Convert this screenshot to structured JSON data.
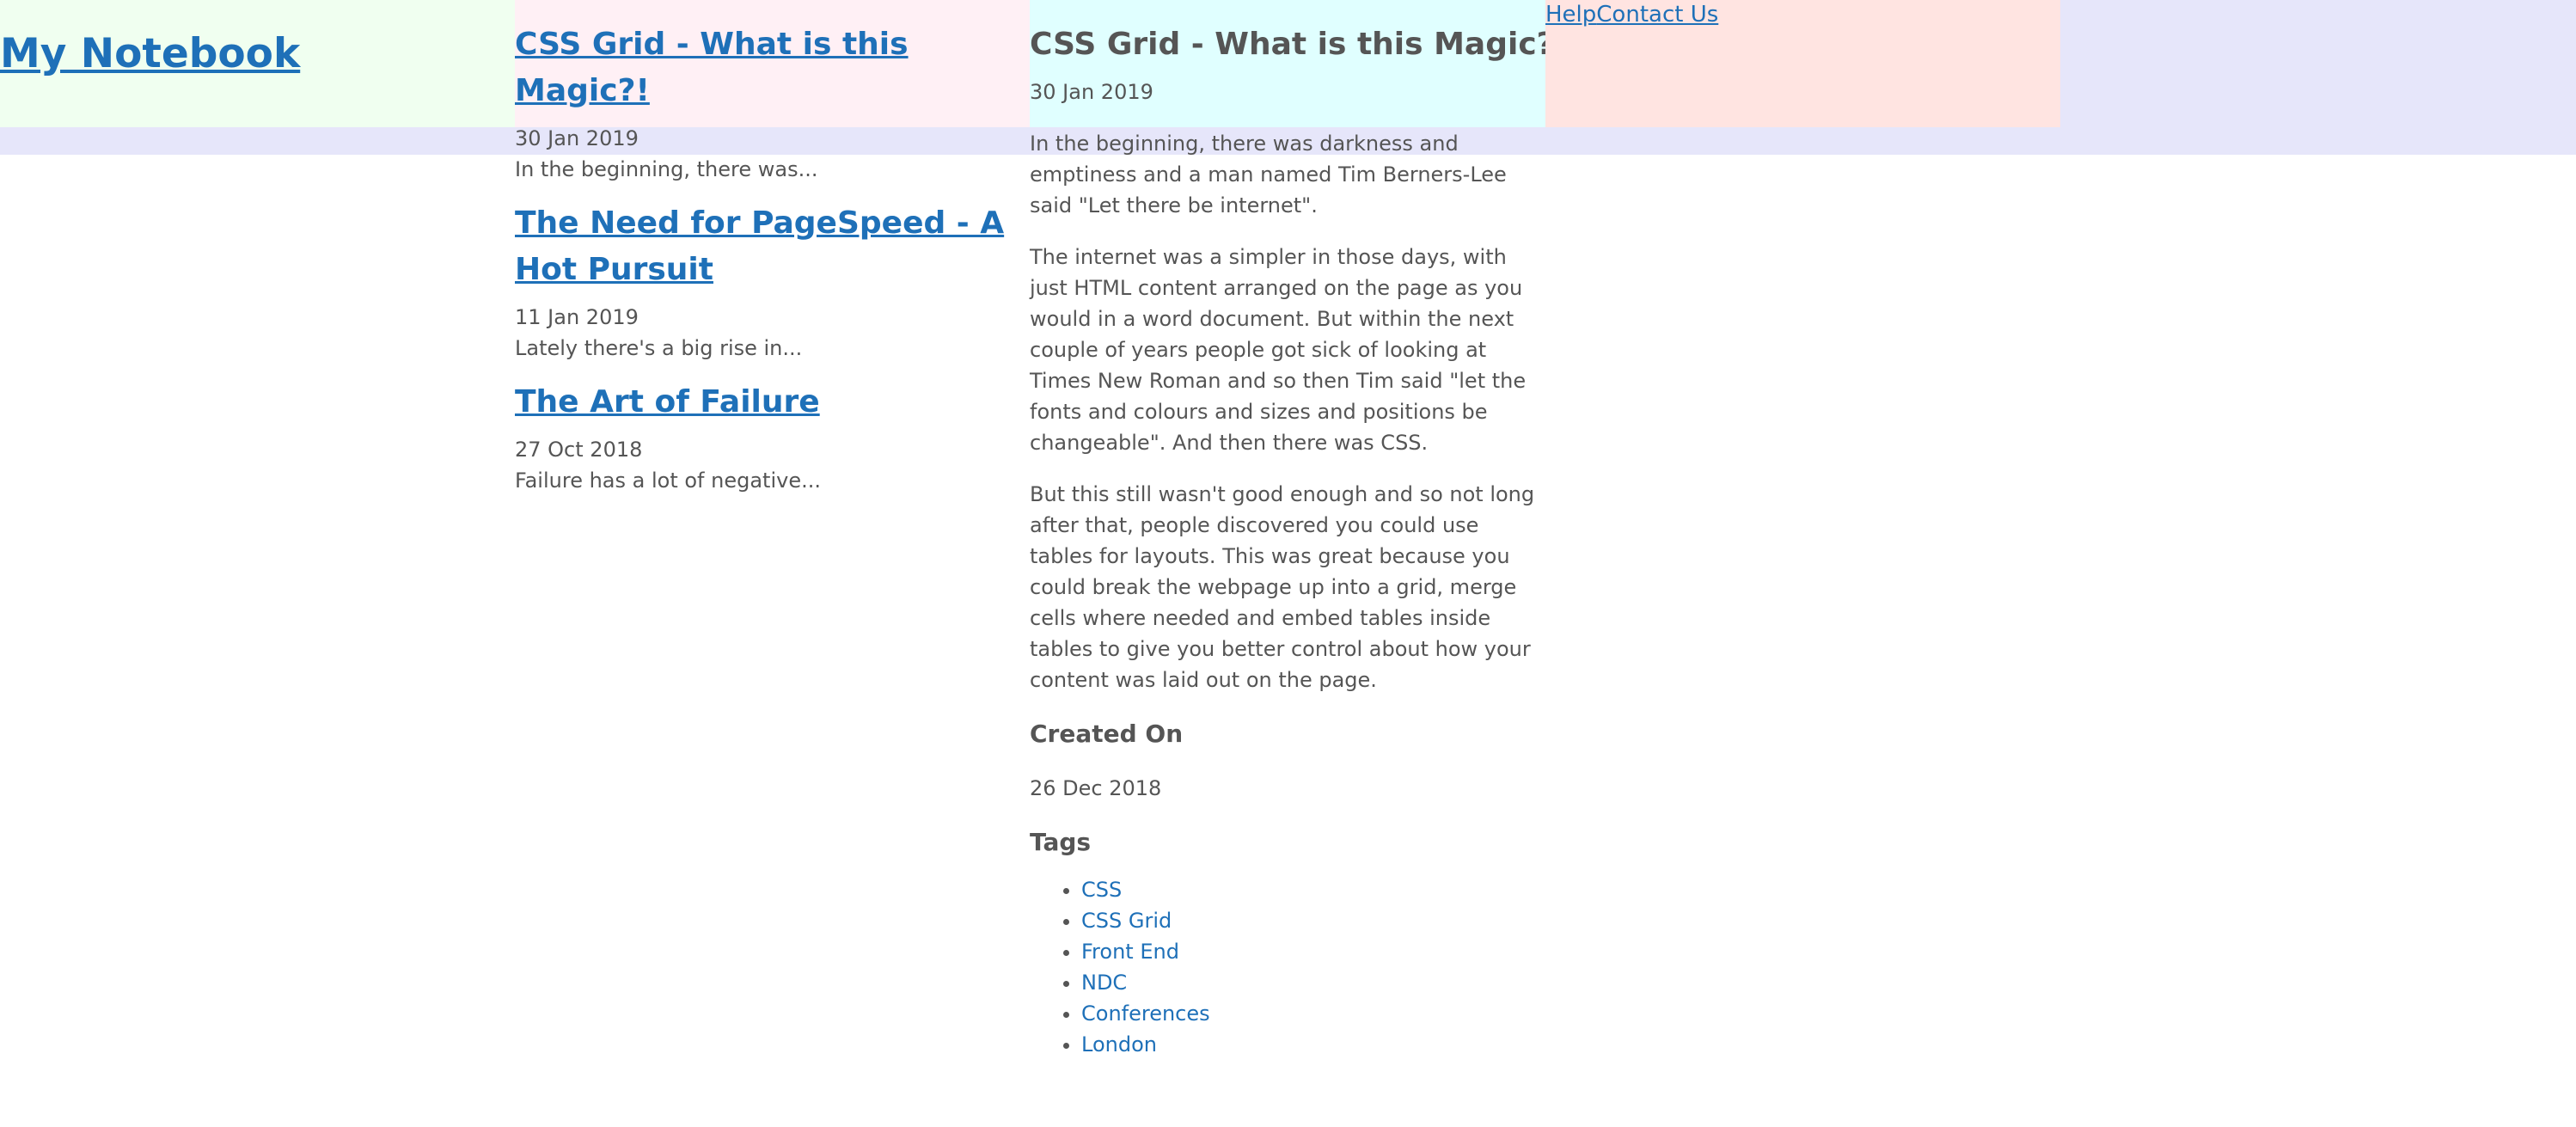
{
  "site": {
    "title": "My Notebook"
  },
  "nav": {
    "help": "Help",
    "contact": "Contact Us"
  },
  "articles": [
    {
      "title": "CSS Grid - What is this Magic?!",
      "date": "30 Jan 2019",
      "excerpt": "In the beginning, there was..."
    },
    {
      "title": "The Need for PageSpeed - A Hot Pursuit",
      "date": "11 Jan 2019",
      "excerpt": "Lately there's a big rise in..."
    },
    {
      "title": "The Art of Failure",
      "date": "27 Oct 2018",
      "excerpt": "Failure has a lot of negative..."
    }
  ],
  "post": {
    "title": "CSS Grid - What is this Magic?!",
    "date": "30 Jan 2019",
    "paragraphs": [
      "In the beginning, there was darkness and emptiness and a man named Tim Berners-Lee said \"Let there be internet\".",
      "The internet was a simpler in those days, with just HTML content arranged on the page as you would in a word document. But within the next couple of years people got sick of looking at Times New Roman and so then Tim said \"let the fonts and colours and sizes and positions be changeable\". And then there was CSS.",
      "But this still wasn't good enough and so not long after that, people discovered you could use tables for layouts. This was great because you could break the webpage up into a grid, merge cells where needed and embed tables inside tables to give you better control about how your content was laid out on the page."
    ],
    "created_heading": "Created On",
    "created_date": "26 Dec 2018",
    "tags_heading": "Tags",
    "tags": [
      "CSS",
      "CSS Grid",
      "Front End",
      "NDC",
      "Conferences",
      "London"
    ]
  },
  "colors": {
    "link": "#1e70b8",
    "text": "#555555",
    "header_band": "#e6e6fa",
    "site_header_bg": "#f0fff0",
    "articles_bg": "#fff0f5",
    "content_bg": "#e0ffff",
    "nav_bg": "#ffe4e1"
  }
}
